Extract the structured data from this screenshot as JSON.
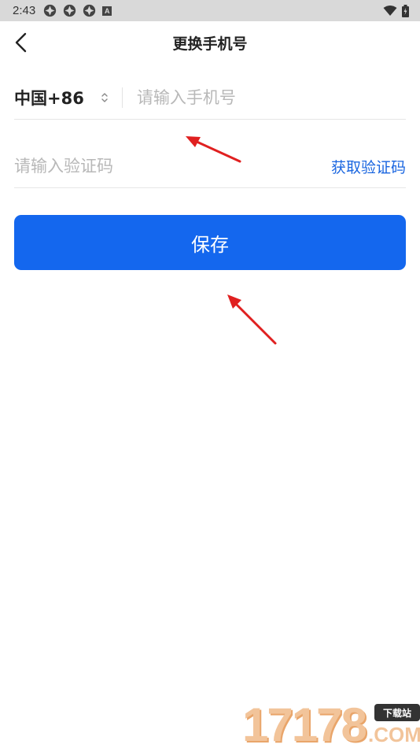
{
  "status_bar": {
    "time": "2:43",
    "notification_icons": [
      "app-notification-icon",
      "app-notification-icon",
      "app-notification-icon",
      "keyboard-a-icon"
    ],
    "a_icon_text": "A",
    "right_icons": [
      "wifi-icon",
      "battery-icon"
    ]
  },
  "header": {
    "title": "更换手机号",
    "back_icon": "chevron-left-icon"
  },
  "phone": {
    "country_code": "中国+86",
    "placeholder": "请输入手机号",
    "value": ""
  },
  "code": {
    "placeholder": "请输入验证码",
    "value": "",
    "get_code_label": "获取验证码"
  },
  "save_label": "保存",
  "watermark": {
    "digits": "17178",
    "badge": "下载站",
    "suffix": ".COM"
  },
  "colors": {
    "primary": "#1467ee",
    "link": "#1a66e0",
    "annotation_arrow": "#e02020",
    "status_bar": "#d9d9d9"
  }
}
